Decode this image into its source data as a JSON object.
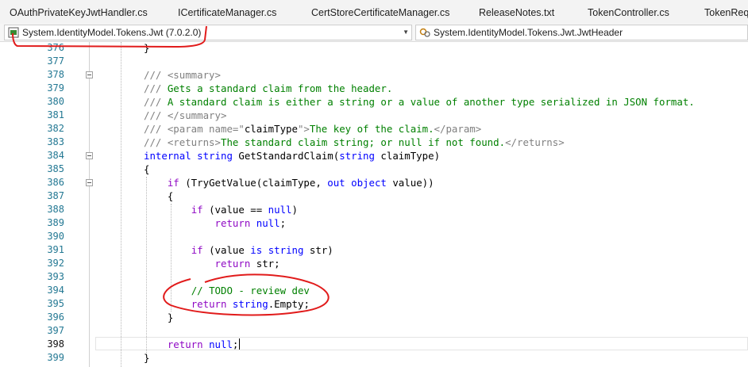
{
  "tabs": [
    {
      "label": "OAuthPrivateKeyJwtHandler.cs"
    },
    {
      "label": "ICertificateManager.cs"
    },
    {
      "label": "CertStoreCertificateManager.cs"
    },
    {
      "label": "ReleaseNotes.txt"
    },
    {
      "label": "TokenController.cs"
    },
    {
      "label": "TokenRequ"
    }
  ],
  "navbar": {
    "project": "System.IdentityModel.Tokens.Jwt (7.0.2.0)",
    "type": "System.IdentityModel.Tokens.Jwt.JwtHeader",
    "project_icon": "csharp-project-icon",
    "type_icon": "class-member-icon"
  },
  "editor": {
    "current_line": "398",
    "lines": [
      {
        "num": "376",
        "tokens": [
          {
            "t": "}",
            "c": ""
          }
        ]
      },
      {
        "num": "377",
        "tokens": []
      },
      {
        "num": "378",
        "tokens": [
          {
            "t": "/// ",
            "c": "doc"
          },
          {
            "t": "<summary>",
            "c": "doc"
          }
        ]
      },
      {
        "num": "379",
        "tokens": [
          {
            "t": "/// ",
            "c": "doc"
          },
          {
            "t": "Gets a standard claim from the header.",
            "c": "cm"
          }
        ]
      },
      {
        "num": "380",
        "tokens": [
          {
            "t": "/// ",
            "c": "doc"
          },
          {
            "t": "A standard claim is either a string or a value of another type serialized in JSON format.",
            "c": "cm"
          }
        ]
      },
      {
        "num": "381",
        "tokens": [
          {
            "t": "/// ",
            "c": "doc"
          },
          {
            "t": "</summary>",
            "c": "doc"
          }
        ]
      },
      {
        "num": "382",
        "tokens": [
          {
            "t": "/// ",
            "c": "doc"
          },
          {
            "t": "<param name=\"",
            "c": "doc"
          },
          {
            "t": "claimType",
            "c": ""
          },
          {
            "t": "\">",
            "c": "doc"
          },
          {
            "t": "The key of the claim.",
            "c": "cm"
          },
          {
            "t": "</param>",
            "c": "doc"
          }
        ]
      },
      {
        "num": "383",
        "tokens": [
          {
            "t": "/// ",
            "c": "doc"
          },
          {
            "t": "<returns>",
            "c": "doc"
          },
          {
            "t": "The standard claim string; or null if not found.",
            "c": "cm"
          },
          {
            "t": "</returns>",
            "c": "doc"
          }
        ]
      },
      {
        "num": "384",
        "tokens": [
          {
            "t": "internal",
            "c": "kw"
          },
          {
            "t": " ",
            "c": ""
          },
          {
            "t": "string",
            "c": "kw"
          },
          {
            "t": " GetStandardClaim(",
            "c": ""
          },
          {
            "t": "string",
            "c": "kw"
          },
          {
            "t": " claimType)",
            "c": ""
          }
        ]
      },
      {
        "num": "385",
        "tokens": [
          {
            "t": "{",
            "c": ""
          }
        ]
      },
      {
        "num": "386",
        "tokens": [
          {
            "t": "    ",
            "c": ""
          },
          {
            "t": "if",
            "c": "ctl"
          },
          {
            "t": " (TryGetValue(claimType, ",
            "c": ""
          },
          {
            "t": "out",
            "c": "kw"
          },
          {
            "t": " ",
            "c": ""
          },
          {
            "t": "object",
            "c": "kw"
          },
          {
            "t": " value))",
            "c": ""
          }
        ]
      },
      {
        "num": "387",
        "tokens": [
          {
            "t": "    {",
            "c": ""
          }
        ]
      },
      {
        "num": "388",
        "tokens": [
          {
            "t": "        ",
            "c": ""
          },
          {
            "t": "if",
            "c": "ctl"
          },
          {
            "t": " (value == ",
            "c": ""
          },
          {
            "t": "null",
            "c": "kw"
          },
          {
            "t": ")",
            "c": ""
          }
        ]
      },
      {
        "num": "389",
        "tokens": [
          {
            "t": "            ",
            "c": ""
          },
          {
            "t": "return",
            "c": "ctl"
          },
          {
            "t": " ",
            "c": ""
          },
          {
            "t": "null",
            "c": "kw"
          },
          {
            "t": ";",
            "c": ""
          }
        ]
      },
      {
        "num": "390",
        "tokens": []
      },
      {
        "num": "391",
        "tokens": [
          {
            "t": "        ",
            "c": ""
          },
          {
            "t": "if",
            "c": "ctl"
          },
          {
            "t": " (value ",
            "c": ""
          },
          {
            "t": "is",
            "c": "kw"
          },
          {
            "t": " ",
            "c": ""
          },
          {
            "t": "string",
            "c": "kw"
          },
          {
            "t": " str)",
            "c": ""
          }
        ]
      },
      {
        "num": "392",
        "tokens": [
          {
            "t": "            ",
            "c": ""
          },
          {
            "t": "return",
            "c": "ctl"
          },
          {
            "t": " str;",
            "c": ""
          }
        ]
      },
      {
        "num": "393",
        "tokens": []
      },
      {
        "num": "394",
        "tokens": [
          {
            "t": "        ",
            "c": ""
          },
          {
            "t": "// TODO - review dev",
            "c": "cm"
          }
        ]
      },
      {
        "num": "395",
        "tokens": [
          {
            "t": "        ",
            "c": ""
          },
          {
            "t": "return",
            "c": "ctl"
          },
          {
            "t": " ",
            "c": ""
          },
          {
            "t": "string",
            "c": "kw"
          },
          {
            "t": ".Empty;",
            "c": ""
          }
        ]
      },
      {
        "num": "396",
        "tokens": [
          {
            "t": "    }",
            "c": ""
          }
        ]
      },
      {
        "num": "397",
        "tokens": []
      },
      {
        "num": "398",
        "tokens": [
          {
            "t": "    ",
            "c": ""
          },
          {
            "t": "return",
            "c": "ctl"
          },
          {
            "t": " ",
            "c": ""
          },
          {
            "t": "null",
            "c": "kw"
          },
          {
            "t": ";",
            "c": ""
          }
        ]
      },
      {
        "num": "399",
        "tokens": [
          {
            "t": "}",
            "c": ""
          }
        ]
      }
    ]
  },
  "annotations": {
    "color": "#e11b1b"
  }
}
